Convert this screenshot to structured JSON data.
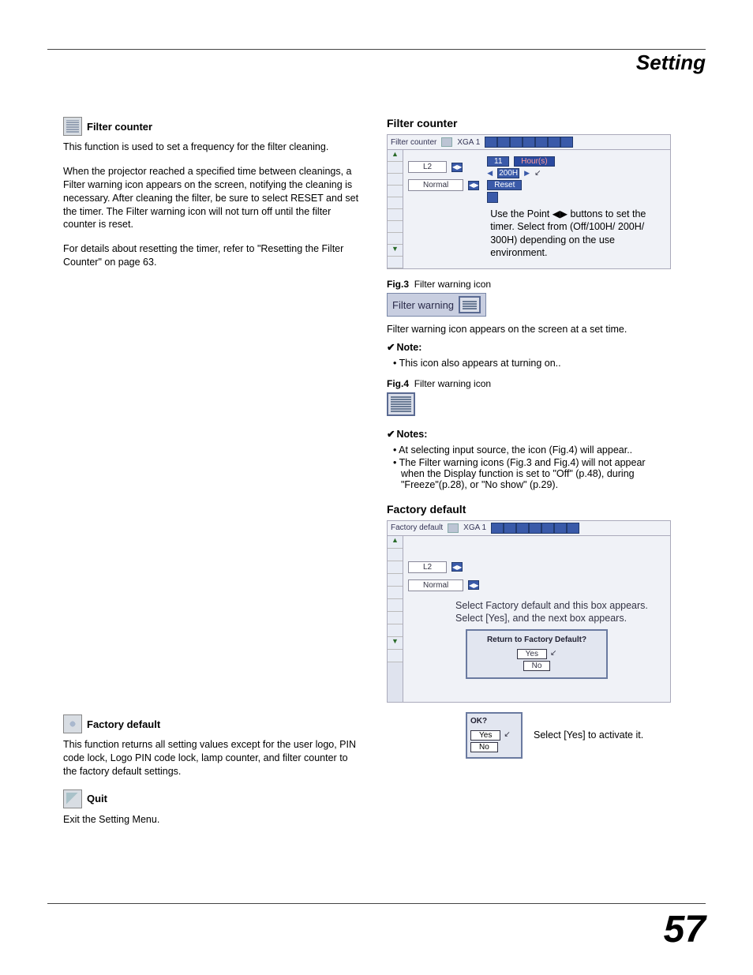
{
  "header": {
    "title": "Setting"
  },
  "left": {
    "filter_counter": {
      "heading": "Filter counter",
      "p1": "This function is used to set a frequency for the filter cleaning.",
      "p2": "When the projector reached a specified time between cleanings, a Filter warning icon appears on the screen, notifying the cleaning is necessary. After cleaning the filter, be sure to select RESET and set the timer. The Filter warning icon will not turn off until the filter counter is reset.",
      "p3": "For details about resetting the timer, refer to \"Resetting the Filter Counter\" on page 63."
    },
    "factory_default": {
      "heading": "Factory default",
      "p": "This function returns all setting values except for the user logo, PIN code lock, Logo PIN code lock, lamp counter, and filter counter to the factory default settings."
    },
    "quit": {
      "heading": "Quit",
      "p": "Exit the Setting Menu."
    }
  },
  "right": {
    "filter_counter": {
      "heading": "Filter counter",
      "ui": {
        "title": "Filter counter",
        "mode": "XGA 1",
        "opt1": "L2",
        "opt2": "Normal",
        "hours_value": "11",
        "hours_label": "Hour(s)",
        "timer_value": "200H",
        "reset_label": "Reset"
      },
      "caption1": "Use the Point ◀▶ buttons to set the timer. Select from (Off/100H/ 200H/ 300H) depending on the use environment.",
      "fig3_label": "Fig.3",
      "fig3_cap": "Filter warning icon",
      "warn_bar_text": "Filter warning",
      "fig3_desc": "Filter warning icon appears on the screen at a set time.",
      "note1_head": "Note:",
      "note1_item": "This icon also appears at turning on..",
      "fig4_label": "Fig.4",
      "fig4_cap": "Filter warning icon",
      "notes_head": "Notes:",
      "notes_item1": "At selecting input source, the icon (Fig.4) will appear..",
      "notes_item2": "The Filter warning icons (Fig.3 and Fig.4) will not appear when the Display function is set to \"Off\" (p.48), during \"Freeze\"(p.28), or \"No show\" (p.29)."
    },
    "factory_default": {
      "heading": "Factory default",
      "ui": {
        "title": "Factory default",
        "mode": "XGA 1",
        "opt1": "L2",
        "opt2": "Normal"
      },
      "annot1": "Select Factory default and this box appears. Select [Yes], and the next box appears.",
      "dlg1_q": "Return to Factory Default?",
      "dlg_yes": "Yes",
      "dlg_no": "No",
      "dlg2_q": "OK?",
      "annot2": "Select [Yes] to activate it."
    }
  },
  "page_number": "57"
}
